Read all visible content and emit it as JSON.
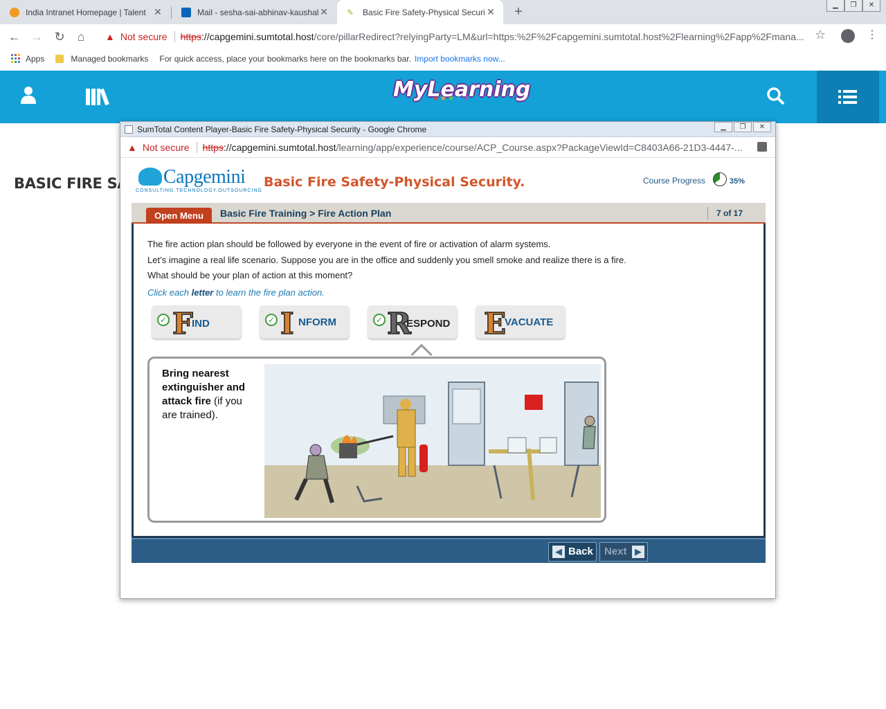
{
  "browser": {
    "tabs": [
      {
        "title": "India Intranet Homepage | Talent",
        "active": false
      },
      {
        "title": "Mail - sesha-sai-abhinav-kaushal",
        "active": false
      },
      {
        "title": "Basic Fire Safety-Physical Security",
        "active": true
      }
    ],
    "address": {
      "security_label": "Not secure",
      "scheme": "https",
      "host": "://capgemini.sumtotal.host",
      "path": "/core/pillarRedirect?relyingParty=LM&url=https:%2F%2Fcapgemini.sumtotal.host%2Flearning%2Fapp%2Fmana..."
    },
    "bookmarks": {
      "apps_label": "Apps",
      "managed_label": "Managed bookmarks",
      "hint": "For quick access, place your bookmarks here on the bookmarks bar.",
      "import_link": "Import bookmarks now..."
    }
  },
  "mylearning": {
    "logo_text": "MyLearning",
    "page_heading": "BASIC FIRE SAI"
  },
  "popup": {
    "window_title": "SumTotal Content Player-Basic Fire Safety-Physical Security - Google Chrome",
    "address": {
      "security_label": "Not secure",
      "scheme": "https",
      "host": "://capgemini.sumtotal.host",
      "path": "/learning/app/experience/course/ACP_Course.aspx?PackageViewId=C8403A66-21D3-4447-..."
    }
  },
  "course": {
    "logo_word": "Capgemini",
    "logo_tagline": "CONSULTING.TECHNOLOGY.OUTSOURCING",
    "title": "Basic Fire Safety-Physical Security.",
    "progress_label": "Course Progress",
    "progress_value": "35%",
    "progress_fraction": 0.35,
    "open_menu_label": "Open Menu",
    "breadcrumb": "Basic Fire Training > Fire Action Plan",
    "page_indicator": "7 of 17",
    "paragraphs": [
      "The fire action plan should be followed by everyone in the event of fire or activation of alarm systems.",
      "Let’s imagine a real life scenario. Suppose you are in the office and suddenly you smell smoke and realize there is a fire.",
      "What should be your plan of action at this moment?"
    ],
    "instruction_pre": "Click each ",
    "instruction_bold": "letter",
    "instruction_post": " to learn the fire plan action.",
    "letters": [
      {
        "letter": "F",
        "rest": "IND",
        "completed": true
      },
      {
        "letter": "I",
        "rest": "NFORM",
        "completed": true
      },
      {
        "letter": "R",
        "rest": "ESPOND",
        "completed": true
      },
      {
        "letter": "E",
        "rest": "VACUATE",
        "completed": false
      }
    ],
    "callout_bold": "Bring nearest extinguisher and attack fire",
    "callout_rest": " (if you are trained).",
    "back_label": "Back",
    "next_label": "Next"
  },
  "colors": {
    "mylearning_blue": "#13a1d8",
    "course_title": "#d2562b",
    "open_menu": "#c1401f",
    "nav_bar": "#2c5d86"
  }
}
